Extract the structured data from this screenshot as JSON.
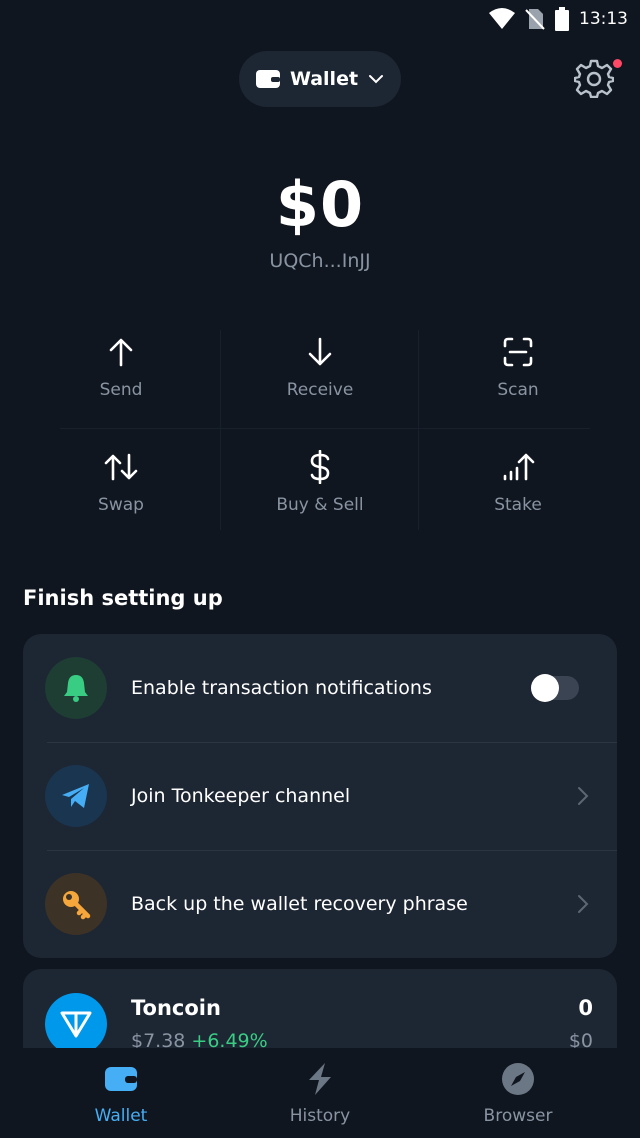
{
  "status_bar": {
    "time": "13:13"
  },
  "header": {
    "wallet_label": "Wallet"
  },
  "balance": {
    "amount": "$0",
    "address": "UQCh...InJJ"
  },
  "actions": [
    {
      "label": "Send",
      "icon": "arrow-up-icon"
    },
    {
      "label": "Receive",
      "icon": "arrow-down-icon"
    },
    {
      "label": "Scan",
      "icon": "scan-icon"
    },
    {
      "label": "Swap",
      "icon": "swap-icon"
    },
    {
      "label": "Buy & Sell",
      "icon": "dollar-icon"
    },
    {
      "label": "Stake",
      "icon": "stake-icon"
    }
  ],
  "setup": {
    "title": "Finish setting up",
    "items": [
      {
        "label": "Enable transaction notifications",
        "icon": "bell-icon",
        "toggle_on": false
      },
      {
        "label": "Join Tonkeeper channel",
        "icon": "telegram-icon"
      },
      {
        "label": "Back up the wallet recovery phrase",
        "icon": "key-icon"
      }
    ]
  },
  "tokens": [
    {
      "name": "Toncoin",
      "price": "$7.38",
      "change": "+6.49%",
      "amount": "0",
      "fiat": "$0"
    }
  ],
  "tabs": [
    {
      "label": "Wallet",
      "icon": "wallet-icon",
      "active": true
    },
    {
      "label": "History",
      "icon": "history-icon",
      "active": false
    },
    {
      "label": "Browser",
      "icon": "compass-icon",
      "active": false
    }
  ],
  "colors": {
    "background": "#10161f",
    "card": "#1d2633",
    "accent": "#45aef5",
    "positive": "#39cc83",
    "notification_dot": "#ff4766",
    "ton_blue": "#0098ea"
  }
}
